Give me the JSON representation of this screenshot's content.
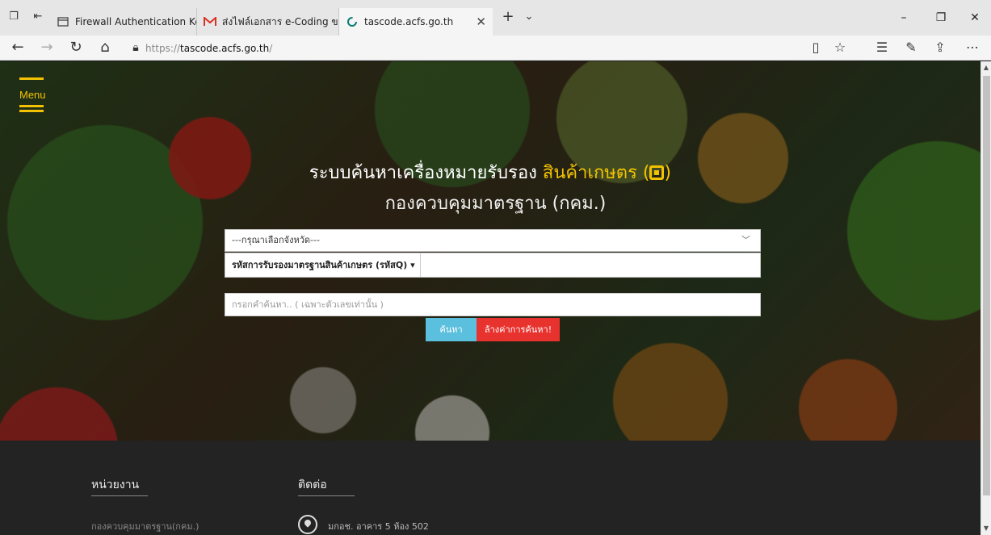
{
  "browser": {
    "tabs": [
      {
        "title": "Firewall Authentication Keej",
        "icon": "page-icon"
      },
      {
        "title": "ส่งไฟล์เอกสาร e-Coding ของค่",
        "icon": "gmail-icon"
      },
      {
        "title": "tascode.acfs.go.th",
        "icon": "loading-icon"
      }
    ],
    "url": {
      "prefix": "https://",
      "host": "tascode.acfs.go.th",
      "suffix": "/"
    }
  },
  "hero": {
    "menu_label": "Menu",
    "title_main": "ระบบค้นหาเครื่องหมายรับรอง ",
    "title_accent": "สินค้าเกษตร (",
    "title_accent_end": ")",
    "subtitle": "กองควบคุมมาตรฐาน (กคม.)",
    "province_placeholder": "---กรุณาเลือกจังหวัด---",
    "code_type": "รหัสการรับรองมาตรฐานสินค้าเกษตร (รหัสQ) ▾",
    "search_placeholder": "กรอกคำค้นหา.. ( เฉพาะตัวเลขเท่านั้น )",
    "search_button": "ค้นหา",
    "clear_button": "ล้างค่าการค้นหา!"
  },
  "footer": {
    "org_heading": "หน่วยงาน",
    "org_name": "กองควบคุมมาตรฐาน(กคม.)",
    "contact_heading": "ติดต่อ",
    "address": "มกอช. อาคาร 5 ห้อง 502"
  },
  "colors": {
    "accent_yellow": "#f2c200",
    "search_button": "#5bc0de",
    "clear_button": "#e8322e"
  }
}
